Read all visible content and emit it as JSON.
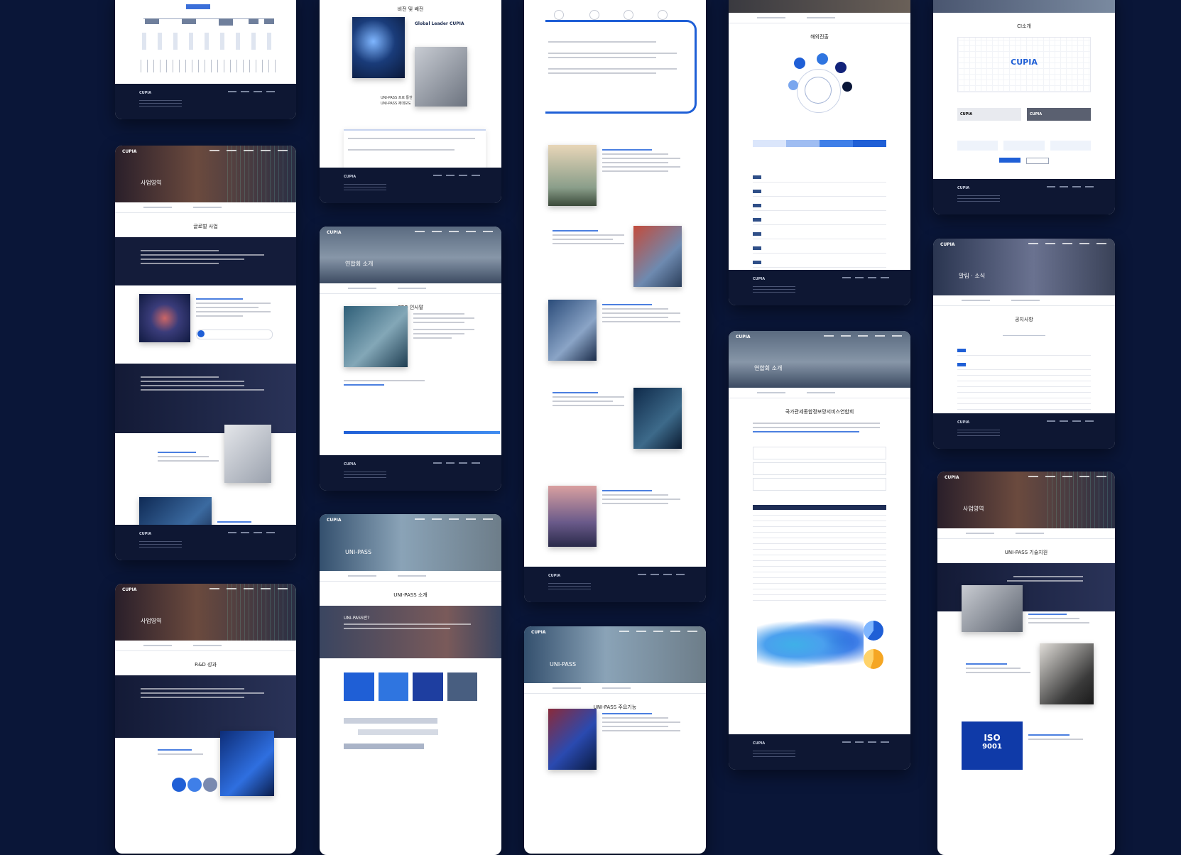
{
  "brand": {
    "logo": "CUPIA"
  },
  "cards": {
    "org": {
      "footer_logo": "CUPIA"
    },
    "business": {
      "hero_title": "사업영역",
      "section_title": "글로벌 사업",
      "footer_logo": "CUPIA"
    },
    "rnd": {
      "hero_title": "사업영역",
      "section_title": "R&D 성과"
    },
    "vision": {
      "section_title": "비전 및 배전",
      "tagline": "Global Leader CUPIA",
      "sub_line1": "UNI-PASS 프로 통한",
      "sub_line2": "UNI-PASS 제대보도",
      "footer_logo": "CUPIA"
    },
    "intro": {
      "hero_title": "연합회 소개",
      "section_title": "CEO 인사말",
      "footer_logo": "CUPIA"
    },
    "unipass": {
      "hero_title": "UNI-PASS",
      "section_title": "UNI-PASS 소개",
      "band_title": "UNI-PASS란?"
    },
    "features": {
      "footer_logo": "CUPIA"
    },
    "unipass2": {
      "hero_title": "UNI-PASS",
      "section_title": "UNI-PASS 주요기능"
    },
    "overseas": {
      "section_title": "해외진출",
      "footer_logo": "CUPIA"
    },
    "intro2": {
      "hero_title": "연합회 소개",
      "headline": "국가관세종합정보망서비스연합회",
      "footer_logo": "CUPIA"
    },
    "ci": {
      "section_title": "CI소개",
      "logo_text": "CUPIA",
      "label_a": "CUPIA",
      "label_b": "CUPIA",
      "footer_logo": "CUPIA"
    },
    "notice": {
      "hero_title": "알림 · 소식",
      "section_title": "공지사항",
      "footer_logo": "CUPIA"
    },
    "tech": {
      "hero_title": "사업영역",
      "section_title": "UNI-PASS 기술지원",
      "badge": "ISO",
      "badge_num": "9001"
    }
  },
  "colors": {
    "accent": "#1f5fd6",
    "navy": "#0a1638",
    "footer": "#0e1733"
  }
}
